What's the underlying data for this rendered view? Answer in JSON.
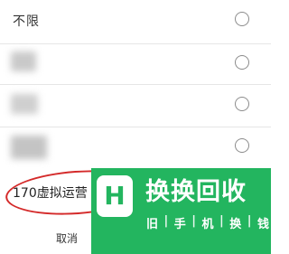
{
  "options": [
    {
      "label": "不限"
    },
    {
      "label": ""
    },
    {
      "label": ""
    },
    {
      "label": ""
    },
    {
      "label": "170虚拟运营"
    }
  ],
  "cancel_label": "取消",
  "watermark": {
    "mark": "H",
    "title": "换换回收",
    "subtitle": [
      "旧",
      "手",
      "机",
      "换",
      "钱"
    ]
  },
  "colors": {
    "accent_green": "#23b55f",
    "annotation_red": "#d42a2a",
    "radio_border": "#8c8c8c"
  }
}
